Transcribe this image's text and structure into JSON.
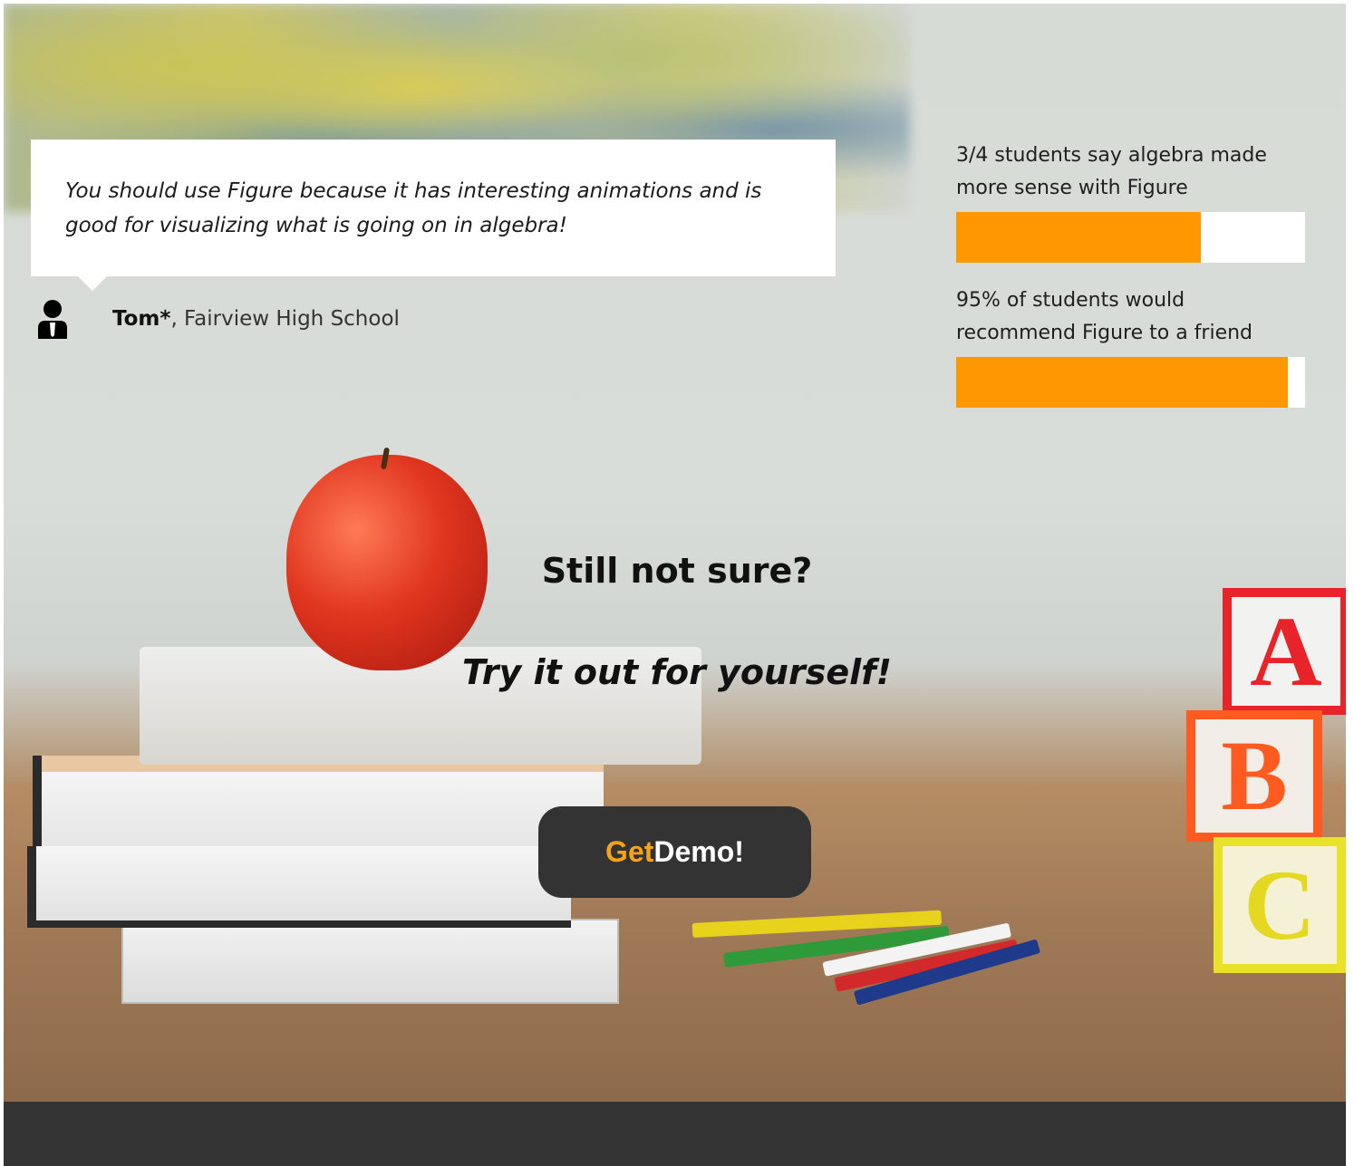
{
  "testimonial": {
    "quote": "You should use Figure because it has interesting animations and is good for visualizing what is going on in algebra!",
    "author_name": "Tom*",
    "author_school": ", Fairview High School"
  },
  "stats": [
    {
      "label": "3/4 students say algebra made more sense with Figure",
      "fraction": 0.7
    },
    {
      "label": "95% of students would recommend Figure to a friend",
      "fraction": 0.95
    }
  ],
  "cta": {
    "title": "Still not sure?",
    "subtitle": "Try it out for yourself!",
    "button_get": "Get",
    "button_rest": "Demo!"
  },
  "colors": {
    "accent": "#ff9800",
    "button_bg": "#333333",
    "button_get": "#f7a21b",
    "footer_bg": "#333333"
  },
  "icons": {
    "author": "person-suit-icon"
  }
}
